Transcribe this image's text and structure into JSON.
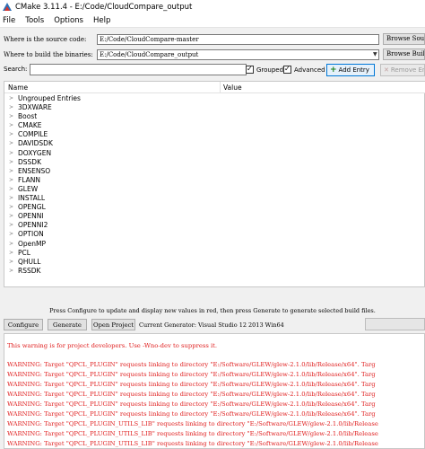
{
  "window": {
    "title": "CMake 3.11.4 - E:/Code/CloudCompare_output"
  },
  "menu": [
    "File",
    "Tools",
    "Options",
    "Help"
  ],
  "source": {
    "label": "Where is the source code:",
    "value": "E:/Code/CloudCompare-master",
    "browse_label": "Browse Source..."
  },
  "build": {
    "label": "Where to build the binaries:",
    "value": "E:/Code/CloudCompare_output",
    "browse_label": "Browse Build..."
  },
  "search": {
    "label": "Search:",
    "value": ""
  },
  "options": {
    "grouped_label": "Grouped",
    "grouped_checked": true,
    "advanced_label": "Advanced",
    "advanced_checked": true,
    "add_entry_label": "Add Entry",
    "remove_entry_label": "Remove Entry"
  },
  "tree": {
    "col_name": "Name",
    "col_value": "Value",
    "items": [
      "Ungrouped Entries",
      "3DXWARE",
      "Boost",
      "CMAKE",
      "COMPILE",
      "DAVIDSDK",
      "DOXYGEN",
      "DSSDK",
      "ENSENSO",
      "FLANN",
      "GLEW",
      "INSTALL",
      "OPENGL",
      "OPENNI",
      "OPENNI2",
      "OPTION",
      "OpenMP",
      "PCL",
      "QHULL",
      "RSSDK"
    ]
  },
  "hint": "Press Configure to update and display new values in red, then press Generate to generate selected build files.",
  "actions": {
    "configure_label": "Configure",
    "generate_label": "Generate",
    "open_project_label": "Open Project"
  },
  "generator": "Current Generator: Visual Studio 12 2013 Win64",
  "output": {
    "lines": [
      "This warning is for project developers.  Use -Wno-dev to suppress it.",
      "",
      "WARNING: Target \"QPCL_PLUGIN\" requests linking to directory \"E:/Software/GLEW/glew-2.1.0/lib/Release/x64\".  Targ",
      "WARNING: Target \"QPCL_PLUGIN\" requests linking to directory \"E:/Software/GLEW/glew-2.1.0/lib/Release/x64\".  Targ",
      "WARNING: Target \"QPCL_PLUGIN\" requests linking to directory \"E:/Software/GLEW/glew-2.1.0/lib/Release/x64\".  Targ",
      "WARNING: Target \"QPCL_PLUGIN\" requests linking to directory \"E:/Software/GLEW/glew-2.1.0/lib/Release/x64\".  Targ",
      "WARNING: Target \"QPCL_PLUGIN\" requests linking to directory \"E:/Software/GLEW/glew-2.1.0/lib/Release/x64\".  Targ",
      "WARNING: Target \"QPCL_PLUGIN\" requests linking to directory \"E:/Software/GLEW/glew-2.1.0/lib/Release/x64\".  Targ",
      "WARNING: Target \"QPCL_PLUGIN_UTILS_LIB\" requests linking to directory \"E:/Software/GLEW/glew-2.1.0/lib/Release",
      "WARNING: Target \"QPCL_PLUGIN_UTILS_LIB\" requests linking to directory \"E:/Software/GLEW/glew-2.1.0/lib/Release",
      "WARNING: Target \"QPCL_PLUGIN_UTILS_LIB\" requests linking to directory \"E:/Software/GLEW/glew-2.1.0/lib/Release"
    ]
  },
  "colors": {
    "accent": "#0078d7",
    "warning": "#e02020"
  }
}
